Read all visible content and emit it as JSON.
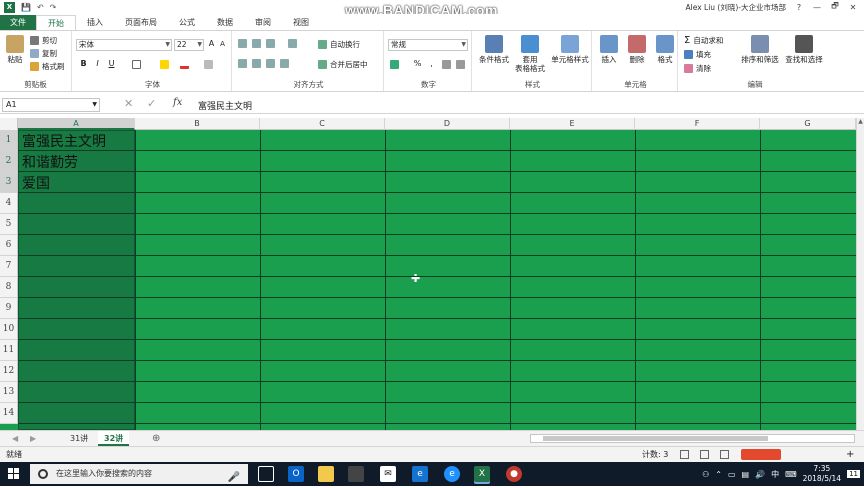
{
  "titlebar": {
    "user": "Alex Liu (刘晓)-大企业市场部",
    "help": "?",
    "minimize": "—",
    "restore": "🗗",
    "close": "✕",
    "qat_save": "💾",
    "qat_undo": "↶",
    "qat_redo": "↷",
    "watermark": "www.BANDICAM.com"
  },
  "tabs": [
    "文件",
    "开始",
    "插入",
    "页面布局",
    "公式",
    "数据",
    "审阅",
    "视图"
  ],
  "ribbon": {
    "clipboard": {
      "label": "剪贴板",
      "paste": "粘贴",
      "cut": "剪切",
      "copy": "复制",
      "format_painter": "格式刷"
    },
    "font": {
      "label": "字体",
      "name": "宋体",
      "size": "22",
      "bold": "B",
      "italic": "I",
      "underline": "U",
      "grow": "A",
      "shrink": "A"
    },
    "alignment": {
      "label": "对齐方式",
      "wrap": "自动换行",
      "merge": "合并后居中"
    },
    "number": {
      "label": "数字",
      "format": "常规",
      "percent": "%",
      "comma": ","
    },
    "styles": {
      "label": "样式",
      "conditional": "条件格式",
      "table": "套用\n表格格式",
      "cell_styles": "单元格样式"
    },
    "cells": {
      "label": "单元格",
      "insert": "插入",
      "delete": "删除",
      "format": "格式"
    },
    "editing": {
      "label": "编辑",
      "autosum": "自动求和",
      "fill": "填充",
      "clear": "清除",
      "sort": "排序和筛选",
      "find": "查找和选择"
    }
  },
  "formulabar": {
    "namebox": "A1",
    "cancel": "✕",
    "enter": "✓",
    "fx": "fx",
    "formula": "富强民主文明"
  },
  "grid": {
    "columns": [
      "A",
      "B",
      "C",
      "D",
      "E",
      "F",
      "G"
    ],
    "rows": [
      "1",
      "2",
      "3",
      "4",
      "5",
      "6",
      "7",
      "8",
      "9",
      "10",
      "11",
      "12",
      "13",
      "14"
    ],
    "cells": {
      "A1": "富强民主文明",
      "A2": "和谐勤劳",
      "A3": "爱国"
    },
    "cursor": "✚"
  },
  "sheets": {
    "tabs": [
      "31讲",
      "32讲"
    ],
    "active": "32讲",
    "add": "⊕"
  },
  "status": {
    "mode": "就绪",
    "count": "计数: 3",
    "zoom": "+"
  },
  "taskbar": {
    "search_placeholder": "在这里输入你要搜索的内容",
    "time": "7:35",
    "date": "2018/5/14",
    "ime": "中",
    "notify": "11"
  },
  "colors": {
    "excel_green": "#217346",
    "fill_green": "#1a9f4f",
    "taskbar": "#101b2a"
  }
}
